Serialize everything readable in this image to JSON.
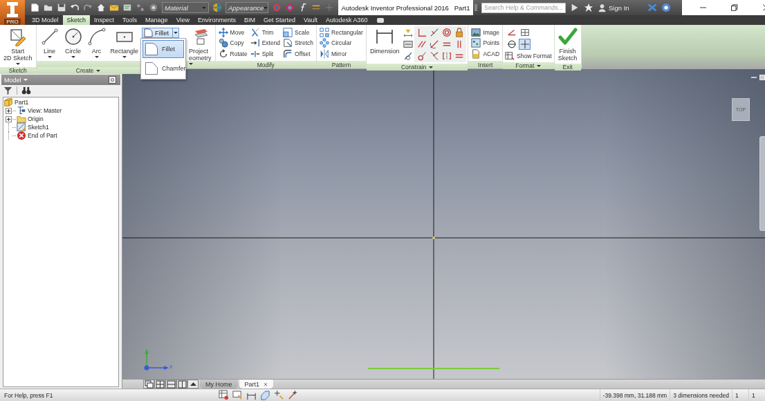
{
  "app_button": {
    "badge": "PRO"
  },
  "quick_access": {
    "material": "Material",
    "appearance": "Appearance"
  },
  "window": {
    "title": "Autodesk Inventor Professional 2016",
    "document": "Part1"
  },
  "help_bar": {
    "search": {
      "placeholder": "Search Help & Commands..."
    },
    "sign_in": "Sign In"
  },
  "tabs": [
    {
      "label": "3D Model",
      "selected": false
    },
    {
      "label": "Sketch",
      "selected": true
    },
    {
      "label": "Inspect",
      "selected": false
    },
    {
      "label": "Tools",
      "selected": false
    },
    {
      "label": "Manage",
      "selected": false
    },
    {
      "label": "View",
      "selected": false
    },
    {
      "label": "Environments",
      "selected": false
    },
    {
      "label": "BIM",
      "selected": false
    },
    {
      "label": "Get Started",
      "selected": false
    },
    {
      "label": "Vault",
      "selected": false
    },
    {
      "label": "Autodesk A360",
      "selected": false
    }
  ],
  "ribbon": {
    "panels": [
      {
        "label": "Sketch",
        "menu": false,
        "groups": [
          {
            "kind": "large",
            "tools": [
              {
                "label": "Start\n2D Sketch",
                "dropdown": true
              }
            ]
          }
        ]
      },
      {
        "label": "Create",
        "menu": true,
        "groups": [
          {
            "kind": "large",
            "tools": [
              {
                "label": "Line",
                "dropdown": true
              },
              {
                "label": "Circle",
                "dropdown": true
              },
              {
                "label": "Arc",
                "dropdown": true
              },
              {
                "label": "Rectangle",
                "dropdown": true
              }
            ]
          },
          {
            "kind": "split",
            "tools": [
              {
                "label": "Fillet",
                "open": true
              }
            ]
          },
          {
            "kind": "large",
            "tools": [
              {
                "label": "Project\neometry",
                "dropdown": true
              }
            ]
          }
        ]
      },
      {
        "label": "Modify",
        "menu": false,
        "groups": [
          {
            "kind": "small",
            "tools": [
              {
                "label": "Move"
              },
              {
                "label": "Copy"
              },
              {
                "label": "Rotate"
              }
            ]
          },
          {
            "kind": "small",
            "tools": [
              {
                "label": "Trim"
              },
              {
                "label": "Extend"
              },
              {
                "label": "Split"
              }
            ]
          },
          {
            "kind": "small",
            "tools": [
              {
                "label": "Scale"
              },
              {
                "label": "Stretch"
              },
              {
                "label": "Offset"
              }
            ]
          }
        ]
      },
      {
        "label": "Pattern",
        "menu": false,
        "groups": [
          {
            "kind": "small",
            "tools": [
              {
                "label": "Rectangular"
              },
              {
                "label": "Circular"
              },
              {
                "label": "Mirror"
              }
            ]
          }
        ]
      },
      {
        "label": "Constrain",
        "menu": true,
        "groups": [
          {
            "kind": "large",
            "tools": [
              {
                "label": "Dimension",
                "dropdown": false
              }
            ]
          },
          {
            "kind": "constraints"
          }
        ]
      },
      {
        "label": "Insert",
        "menu": false,
        "groups": [
          {
            "kind": "small",
            "tools": [
              {
                "label": "Image"
              },
              {
                "label": "Points"
              },
              {
                "label": "ACAD"
              }
            ]
          }
        ]
      },
      {
        "label": "Format",
        "menu": true,
        "groups": [
          {
            "kind": "toggles",
            "tools": [
              {
                "on": false
              },
              {
                "on": false
              },
              {
                "on": false
              },
              {
                "on": true
              }
            ]
          },
          {
            "kind": "small",
            "tools": [
              {
                "label": "Show Format"
              }
            ]
          }
        ]
      },
      {
        "label": "Exit",
        "menu": false,
        "groups": [
          {
            "kind": "large",
            "tools": [
              {
                "label": "Finish\nSketch",
                "dropdown": false
              }
            ]
          }
        ]
      }
    ]
  },
  "fillet_menu": [
    {
      "label": "Fillet",
      "selected": true
    },
    {
      "label": "Chamfer",
      "selected": false
    }
  ],
  "browser": {
    "title": "Model",
    "tree": [
      {
        "label": "Part1",
        "kind": "part",
        "children": [
          {
            "label": "View: Master",
            "kind": "view",
            "collapsed": true
          },
          {
            "label": "Origin",
            "kind": "folder",
            "collapsed": true
          },
          {
            "label": "Sketch1",
            "kind": "sketch",
            "collapsed": false
          },
          {
            "label": "End of Part",
            "kind": "end",
            "collapsed": false
          }
        ]
      }
    ]
  },
  "viewport": {
    "viewcube": "TOP",
    "triad": {
      "x_label": "X"
    }
  },
  "document_tabs": [
    {
      "label": "My Home",
      "selected": false
    },
    {
      "label": "Part1",
      "selected": true
    }
  ],
  "status_bar": {
    "help": "For Help, press F1",
    "coordinates": "-39.398 mm, 31.188 mm",
    "message": "3 dimensions needed",
    "count": "1",
    "count_2": "1"
  }
}
